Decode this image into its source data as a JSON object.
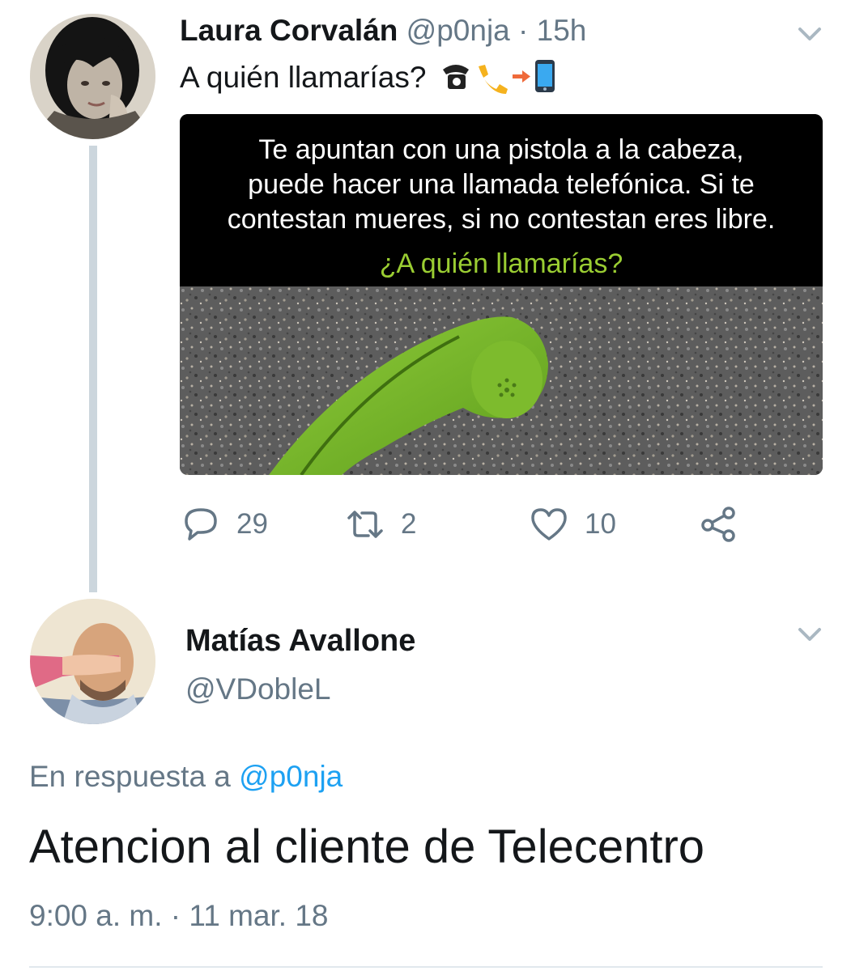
{
  "tweet1": {
    "author_name": "Laura Corvalán",
    "author_handle": "@p0nja",
    "separator": "·",
    "time_ago": "15h",
    "text": "A quién llamarías?",
    "emojis": [
      "telephone-icon",
      "telephone-receiver-icon",
      "arrow-right-icon",
      "mobile-phone-icon"
    ],
    "media": {
      "line1": "Te apuntan con una pistola a la cabeza,",
      "line2": "puede hacer una llamada telefónica. Si te",
      "line3": "contestan mueres, si no contestan eres libre.",
      "question": "¿A quién llamarías?"
    },
    "actions": {
      "replies": "29",
      "retweets": "2",
      "likes": "10"
    }
  },
  "tweet2": {
    "author_name": "Matías Avallone",
    "author_handle": "@VDobleL",
    "reply_prefix": "En respuesta a",
    "reply_handle": "@p0nja",
    "text": "Atencion al cliente de Telecentro",
    "timestamp": "9:00 a. m. · 11 mar. 18"
  },
  "colors": {
    "text_primary": "#14171a",
    "text_muted": "#657786",
    "link_blue": "#1da1f2",
    "thread_line": "#ccd6dd",
    "media_question_green": "#9acd32"
  }
}
